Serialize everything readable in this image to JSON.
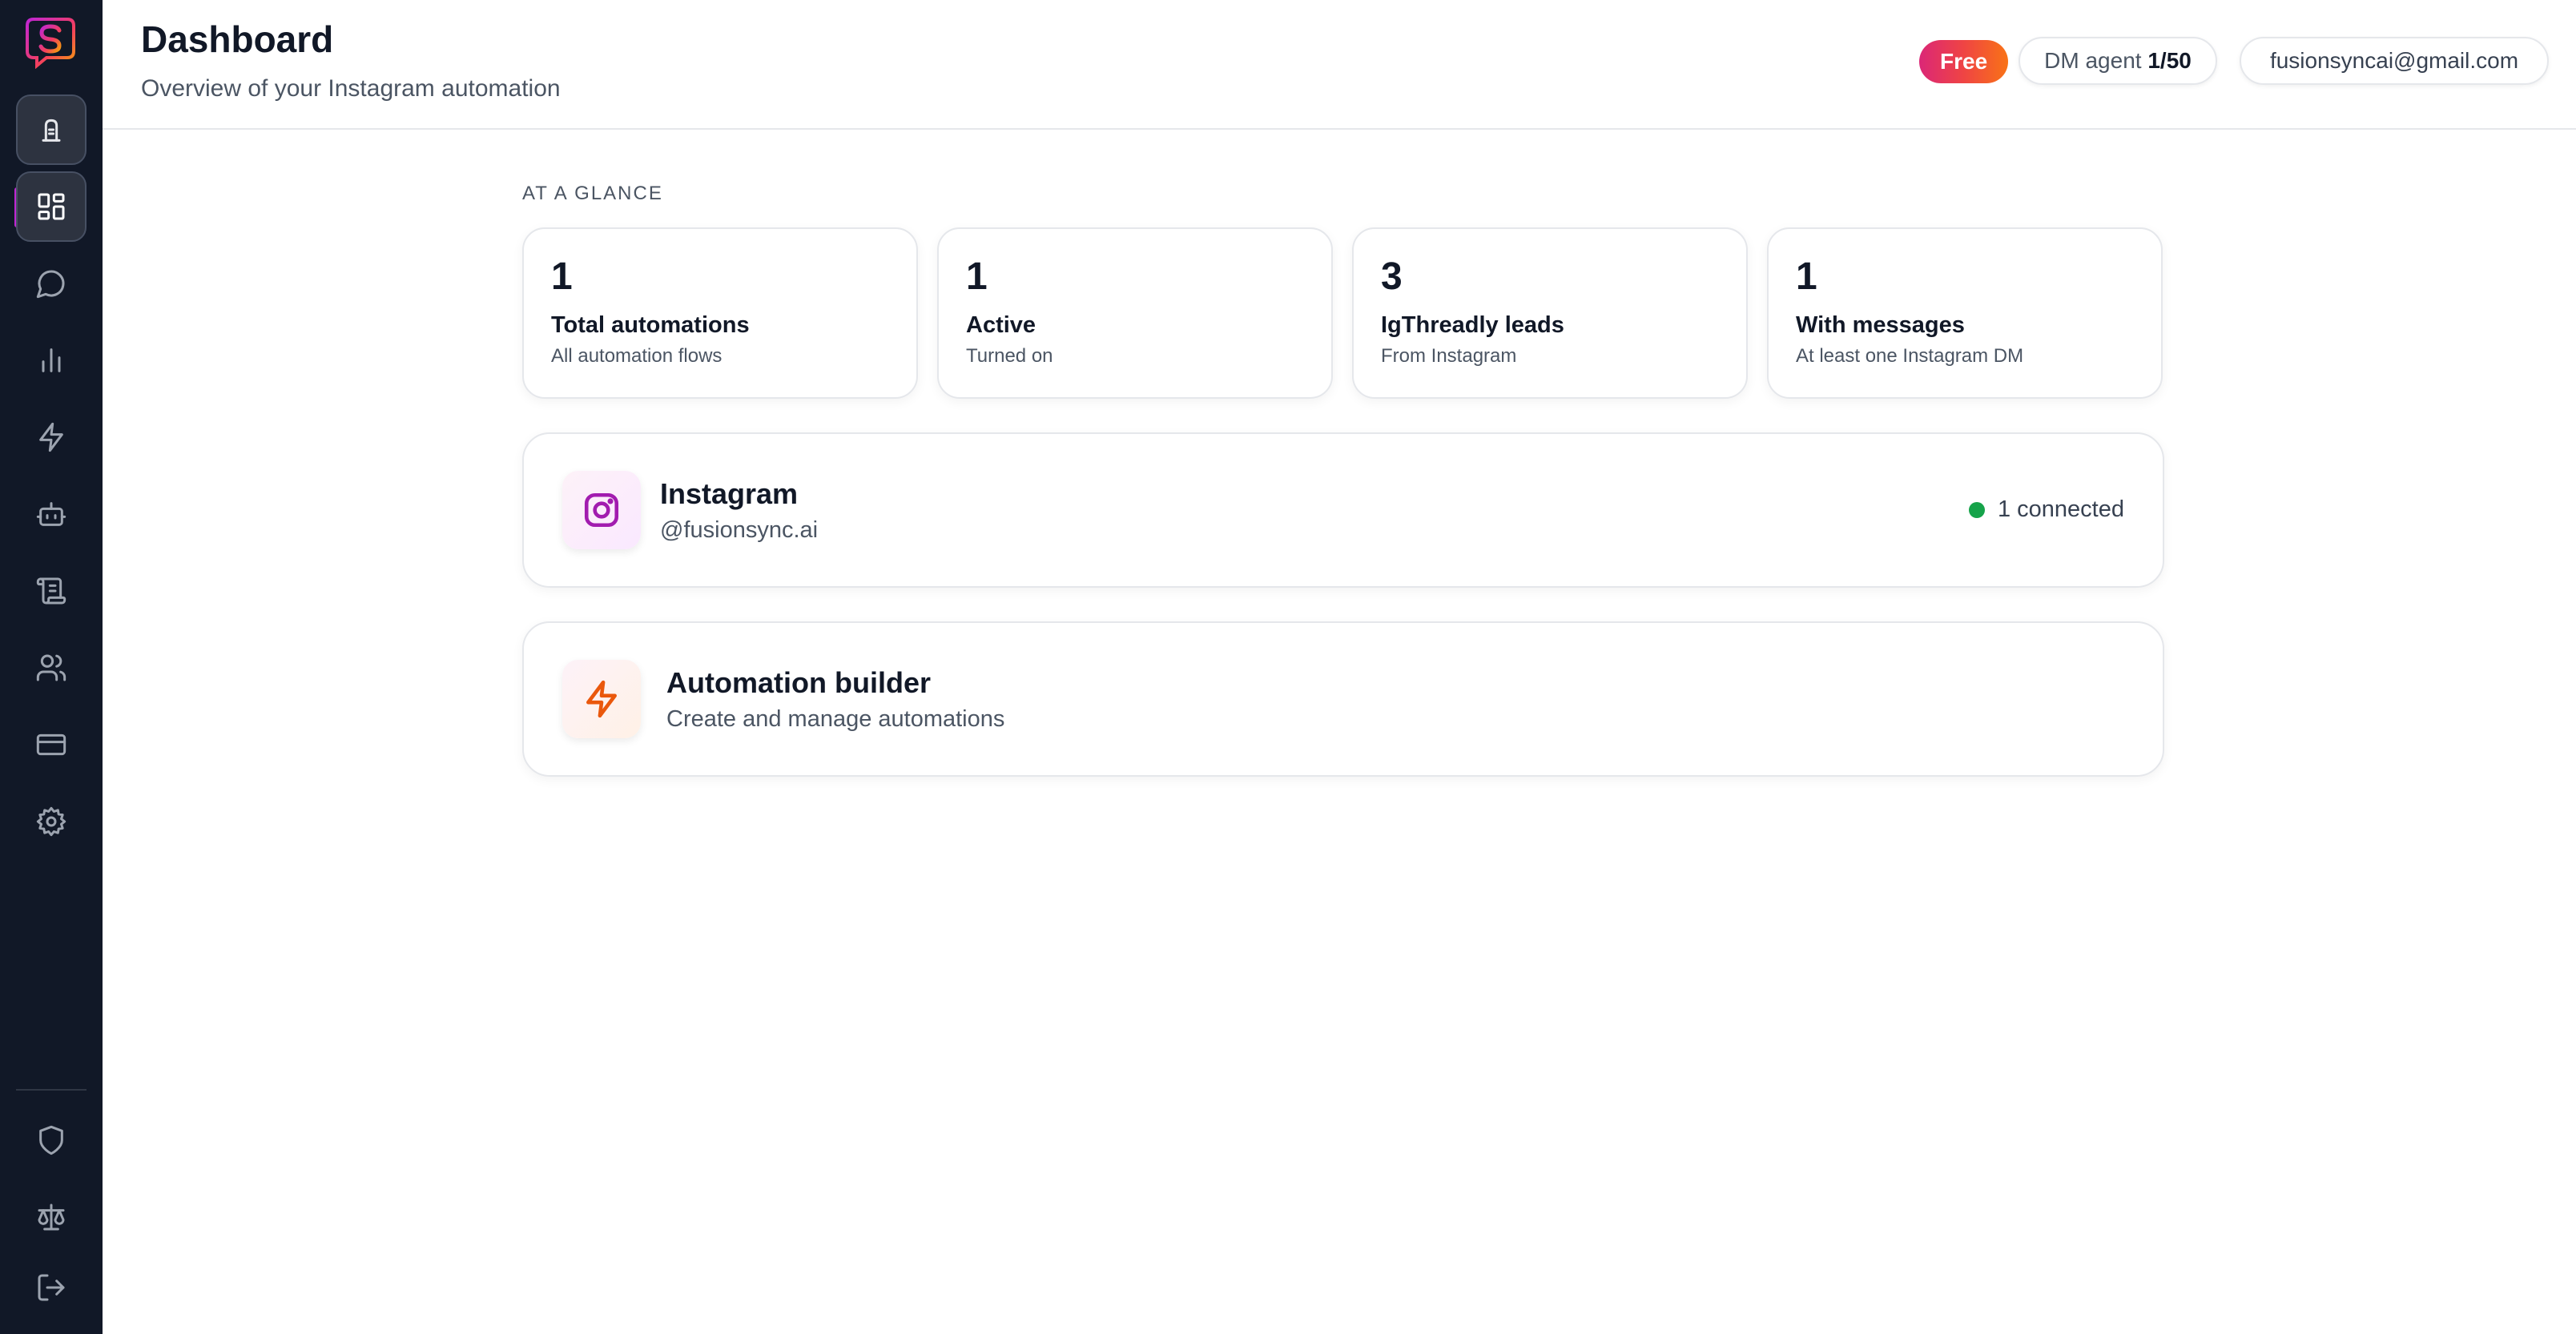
{
  "header": {
    "title": "Dashboard",
    "subtitle": "Overview of your Instagram automation",
    "plan_badge": "Free",
    "dm_agent_label": "DM agent",
    "dm_agent_usage": "1/50",
    "email": "fusionsyncai@gmail.com"
  },
  "sidebar": {
    "top_icons": [
      "brand-logo",
      "building-icon",
      "dashboard-grid-icon",
      "chat-bubble-icon",
      "bar-chart-icon",
      "lightning-icon",
      "bot-icon",
      "scroll-icon",
      "users-icon",
      "credit-card-icon",
      "settings-gear-icon"
    ],
    "bottom_icons": [
      "shield-icon",
      "scale-icon",
      "logout-icon"
    ],
    "active_item": "dashboard-grid-icon"
  },
  "glance": {
    "label": "AT A GLANCE",
    "stats": [
      {
        "value": "1",
        "title": "Total automations",
        "subtitle": "All automation flows"
      },
      {
        "value": "1",
        "title": "Active",
        "subtitle": "Turned on"
      },
      {
        "value": "3",
        "title": "IgThreadly leads",
        "subtitle": "From Instagram"
      },
      {
        "value": "1",
        "title": "With messages",
        "subtitle": "At least one Instagram DM"
      }
    ]
  },
  "instagram_card": {
    "title": "Instagram",
    "handle": "@fusionsync.ai",
    "status": "1 connected",
    "icon": "instagram-icon"
  },
  "builder_card": {
    "title": "Automation builder",
    "subtitle": "Create and manage automations",
    "icon": "lightning-icon"
  },
  "colors": {
    "sidebar_bg": "#111827",
    "accent": "#c026d3",
    "badge_gradient": [
      "#db2777",
      "#ef4444",
      "#f97316"
    ],
    "status_green": "#16a34a"
  }
}
